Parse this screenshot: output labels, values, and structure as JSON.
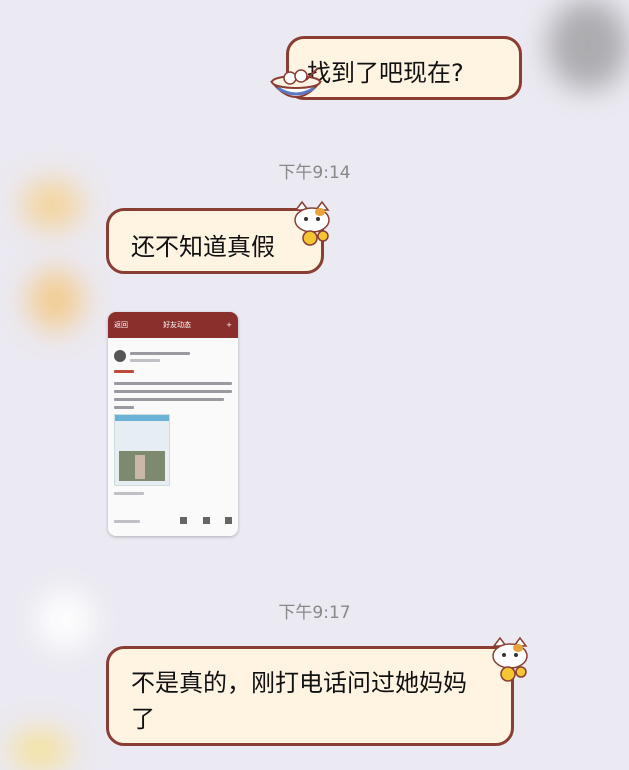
{
  "messages": [
    {
      "side": "right",
      "text": "找到了吧现在?"
    },
    {
      "side": "left",
      "text": "还不知道真假"
    },
    {
      "side": "left",
      "type": "image"
    },
    {
      "side": "left",
      "text": "不是真的，刚打电话问过她妈妈了"
    }
  ],
  "timestamps": [
    "下午9:14",
    "下午9:17"
  ],
  "screenshot": {
    "title": "好友动态",
    "back": "返回"
  },
  "colors": {
    "background": "#ebe9f1",
    "bubble": "#fff4e2",
    "bubble_border": "#8a3e33",
    "timestamp": "#888888"
  }
}
